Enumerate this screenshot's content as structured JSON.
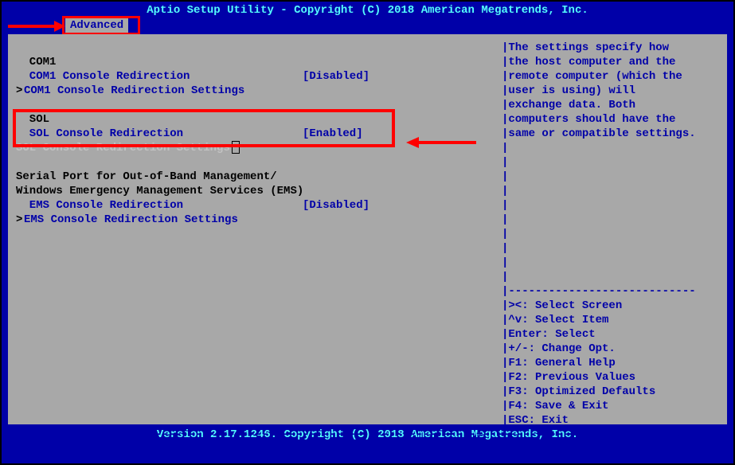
{
  "title": "Aptio Setup Utility - Copyright (C) 2018 American Megatrends, Inc.",
  "tab": "Advanced",
  "content": {
    "com1_header": "  COM1",
    "com1_redir_label": "  COM1 Console Redirection",
    "com1_redir_value": "[Disabled]",
    "com1_settings": " COM1 Console Redirection Settings",
    "sol_header": "  SOL",
    "sol_redir_label": "  SOL Console Redirection",
    "sol_redir_value": "[Enabled]",
    "sol_settings": "SOL Console Redirection Settings",
    "serial_line1": "  Serial Port for Out-of-Band Management/",
    "serial_line2": "  Windows Emergency Management Services (EMS)",
    "ems_redir_label": "  EMS Console Redirection",
    "ems_redir_value": "[Disabled]",
    "ems_settings": " EMS Console Redirection Settings"
  },
  "help": {
    "l1": "|The settings specify how",
    "l2": "|the host computer and the",
    "l3": "|remote computer (which the",
    "l4": "|user is using) will",
    "l5": "|exchange data. Both",
    "l6": "|computers should have the",
    "l7": "|same or compatible settings.",
    "k1": "|><: Select Screen",
    "k2": "|^v: Select Item",
    "k3": "|Enter: Select",
    "k4": "|+/-: Change Opt.",
    "k5": "|F1: General Help",
    "k6": "|F2: Previous Values",
    "k7": "|F3: Optimized Defaults",
    "k8": "|F4: Save & Exit",
    "k9": "|ESC: Exit"
  },
  "footer": "Version 2.17.1246. Copyright (C) 2018 American Megatrends, Inc.",
  "dashes_top": "/---------------------------------------------------------------------+-----------------------------\\",
  "dashes_bottom": "\\---------------------------------------------------------------------+-----------------------------/",
  "help_divider": "|----------------------------",
  "pipe": "|"
}
